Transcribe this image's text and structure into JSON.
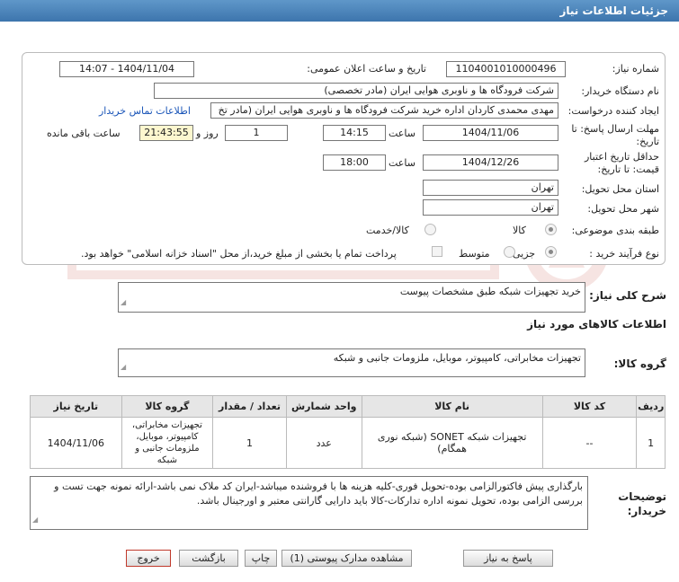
{
  "window": {
    "title": "جزئیات اطلاعات نیاز"
  },
  "form": {
    "need_number_label": "شماره نیاز:",
    "need_number": "1104001010000496",
    "announce_label": "تاریخ و ساعت اعلان عمومی:",
    "announce_value": "1404/11/04 - 14:07",
    "buyer_org_label": "نام دستگاه خریدار:",
    "buyer_org": "شرکت فرودگاه ها و ناوبری هوایی ایران (مادر تخصصی)",
    "creator_label": "ایجاد کننده درخواست:",
    "creator": "مهدی محمدی کاردان اداره خرید شرکت فرودگاه ها و ناوبری هوایی ایران (مادر تخ",
    "contact_link": "اطلاعات تماس خریدار",
    "deadline_label_1": "مهلت ارسال پاسخ: تا",
    "deadline_label_2": "تاریخ:",
    "deadline_date": "1404/11/06",
    "time_label": "ساعت",
    "deadline_time": "14:15",
    "days_value": "1",
    "days_label": "روز و",
    "remaining_time": "21:43:55",
    "remaining_label": "ساعت باقی مانده",
    "validity_label_1": "حداقل تاریخ اعتبار",
    "validity_label_2": "قیمت: تا تاریخ:",
    "validity_date": "1404/12/26",
    "validity_time": "18:00",
    "province_label": "استان محل تحویل:",
    "province": "تهران",
    "city_label": "شهر محل تحویل:",
    "city": "تهران",
    "category_label": "طبقه بندی موضوعی:",
    "category_options": [
      "کالا",
      "کالا/خدمت"
    ],
    "purchase_type_label": "نوع فرآیند خرید :",
    "purchase_options": [
      "جزیی",
      "متوسط"
    ],
    "payment_note": "پرداخت تمام یا بخشی از مبلغ خرید،از محل \"اسناد خزانه اسلامی\" خواهد بود."
  },
  "summary": {
    "label": "شرح کلی نیاز:",
    "value": "خرید تجهیزات شبکه طبق مشخصات پیوست"
  },
  "goods": {
    "section_title": "اطلاعات کالاهای مورد نیاز",
    "group_label": "گروه کالا:",
    "group_value": "تجهیزات مخابراتی، کامپیوتر، موبایل، ملزومات جانبی و شبکه"
  },
  "table": {
    "headers": [
      "ردیف",
      "کد کالا",
      "نام کالا",
      "واحد شمارش",
      "تعداد / مقدار",
      "گروه کالا",
      "تاریخ نیاز"
    ],
    "rows": [
      [
        "1",
        "--",
        "تجهیزات شبکه SONET (شبکه نوری همگام)",
        "عدد",
        "1",
        "تجهیزات مخابراتی، کامپیوتر، موبایل، ملزومات جانبی و شبکه",
        "1404/11/06"
      ]
    ]
  },
  "buyer_notes": {
    "label_1": "توضیحات",
    "label_2": "خریدار:",
    "text": "بارگذاری پیش فاکتورالزامی بوده-تحویل فوری-کلیه هزینه ها با فروشنده میباشد-ایران کد ملاک نمی باشد-ارائه نمونه جهت تست و بررسی الزامی بوده، تحویل نمونه اداره تدارکات-کالا باید دارایی گارانتی معتبر و اورجینال باشد."
  },
  "buttons": {
    "respond": "پاسخ به نیاز",
    "attachments": "مشاهده مدارک پیوستی (1)",
    "print": "چاپ",
    "back": "بازگشت",
    "exit": "خروج"
  },
  "colors": {
    "title_bar": "#4a82ba",
    "link": "#1a55b8",
    "exit_border": "#c0392b",
    "remaining_bg": "#fdf7cf"
  }
}
